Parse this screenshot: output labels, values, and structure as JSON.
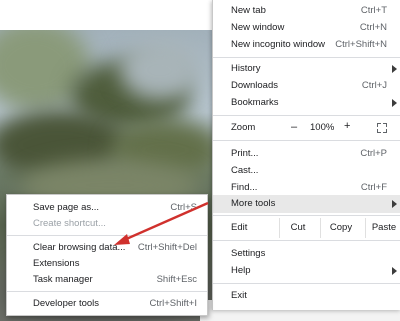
{
  "main_menu": {
    "items": [
      {
        "label": "New tab",
        "shortcut": "Ctrl+T"
      },
      {
        "label": "New window",
        "shortcut": "Ctrl+N"
      },
      {
        "label": "New incognito window",
        "shortcut": "Ctrl+Shift+N"
      },
      {
        "label": "History",
        "shortcut": ""
      },
      {
        "label": "Downloads",
        "shortcut": "Ctrl+J"
      },
      {
        "label": "Bookmarks",
        "shortcut": ""
      },
      {
        "label": "Print...",
        "shortcut": "Ctrl+P"
      },
      {
        "label": "Cast...",
        "shortcut": ""
      },
      {
        "label": "Find...",
        "shortcut": "Ctrl+F"
      },
      {
        "label": "More tools",
        "shortcut": ""
      },
      {
        "label": "Settings",
        "shortcut": ""
      },
      {
        "label": "Help",
        "shortcut": ""
      },
      {
        "label": "Exit",
        "shortcut": ""
      }
    ],
    "zoom": {
      "label": "Zoom",
      "minus": "–",
      "value": "100%",
      "plus": "+"
    },
    "edit": {
      "label": "Edit",
      "cut": "Cut",
      "copy": "Copy",
      "paste": "Paste"
    }
  },
  "sub_menu": {
    "items": [
      {
        "label": "Save page as...",
        "shortcut": "Ctrl+S"
      },
      {
        "label": "Create shortcut...",
        "shortcut": ""
      },
      {
        "label": "Clear browsing data...",
        "shortcut": "Ctrl+Shift+Del"
      },
      {
        "label": "Extensions",
        "shortcut": ""
      },
      {
        "label": "Task manager",
        "shortcut": "Shift+Esc"
      },
      {
        "label": "Developer tools",
        "shortcut": "Ctrl+Shift+I"
      }
    ]
  },
  "colors": {
    "annotation_arrow": "#d0312d",
    "highlight": "#e8e8e8"
  }
}
